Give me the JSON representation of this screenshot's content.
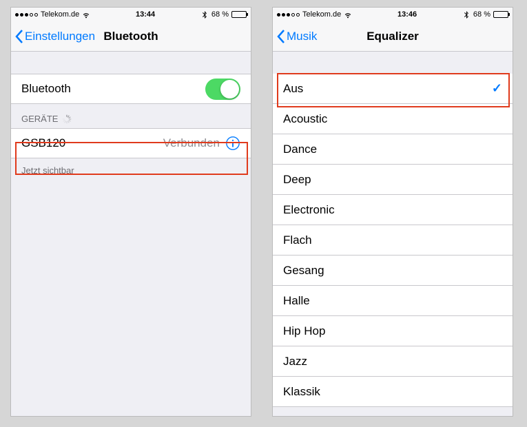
{
  "left": {
    "status": {
      "carrier": "Telekom.de",
      "time": "13:44",
      "battery_pct": "68 %"
    },
    "nav": {
      "back": "Einstellungen",
      "title": "Bluetooth"
    },
    "toggle_row": {
      "label": "Bluetooth",
      "on": true
    },
    "section_header": "GERÄTE",
    "device": {
      "name": "GSB120",
      "status": "Verbunden"
    },
    "footer": "Jetzt sichtbar"
  },
  "right": {
    "status": {
      "carrier": "Telekom.de",
      "time": "13:46",
      "battery_pct": "68 %"
    },
    "nav": {
      "back": "Musik",
      "title": "Equalizer"
    },
    "selected_index": 0,
    "items": [
      "Aus",
      "Acoustic",
      "Dance",
      "Deep",
      "Electronic",
      "Flach",
      "Gesang",
      "Halle",
      "Hip Hop",
      "Jazz",
      "Klassik"
    ]
  }
}
